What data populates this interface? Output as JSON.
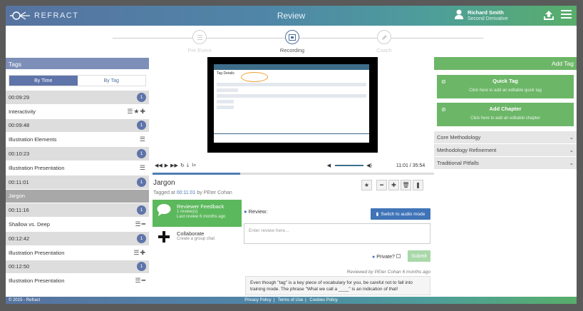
{
  "header": {
    "logo_text": "REFRACT",
    "title": "Review",
    "user_name": "Richard Smith",
    "user_role": "Second Derivative"
  },
  "steps": [
    {
      "label": "Pre Event",
      "active": false
    },
    {
      "label": "Recording",
      "active": true
    },
    {
      "label": "Coach",
      "active": false
    }
  ],
  "tags_panel": {
    "title": "Tags",
    "toggle": [
      "By Time",
      "By Tag"
    ],
    "rows": [
      {
        "label": "00:09:29",
        "kind": "time",
        "badge": "1"
      },
      {
        "label": "Interactivity",
        "kind": "tag",
        "icons": "☰★✚"
      },
      {
        "label": "00:09:48",
        "kind": "time",
        "badge": "1"
      },
      {
        "label": "Illustration Elements",
        "kind": "tag",
        "icons": "☰"
      },
      {
        "label": "00:10:23",
        "kind": "time",
        "badge": "1"
      },
      {
        "label": "Illustration Presentation",
        "kind": "tag",
        "icons": "☰"
      },
      {
        "label": "00:11:01",
        "kind": "time",
        "badge": "1"
      },
      {
        "label": "Jargon",
        "kind": "sel",
        "icons": ""
      },
      {
        "label": "00:11:16",
        "kind": "time",
        "badge": "1"
      },
      {
        "label": "Shallow vs. Deep",
        "kind": "tag",
        "icons": "☰━"
      },
      {
        "label": "00:12:42",
        "kind": "time",
        "badge": "1"
      },
      {
        "label": "Illustration Presentation",
        "kind": "tag",
        "icons": "☰✚"
      },
      {
        "label": "00:12:50",
        "kind": "time",
        "badge": "1"
      },
      {
        "label": "Illustration Presentation",
        "kind": "tag",
        "icons": "☰━"
      }
    ]
  },
  "player": {
    "time": "11:01 / 35:54",
    "progress": 0.31,
    "speed": "1x",
    "screen_heading": "Tag Details"
  },
  "tag_detail": {
    "title": "Jargon",
    "tagged_prefix": "Tagged at",
    "tagged_time": "00:11:01",
    "tagged_suffix": "by PEter Cohan"
  },
  "feedback": [
    {
      "title": "Reviewer Feedback",
      "sub1": "1 review(s)",
      "sub2": "Last review 6 months ago",
      "active": true
    },
    {
      "title": "Collaborate",
      "sub1": "Create a group chat",
      "sub2": "",
      "active": false
    }
  ],
  "review": {
    "label": "Review:",
    "switch_label": "Switch to audio mode",
    "placeholder": "Enter review here...",
    "private_label": "Private?",
    "submit_label": "Submit",
    "meta": "Reviewed by PEter Cohan 6 months ago",
    "text": "Even though \"tag\" is a key piece of vocabulary for you, be careful not to fall into training mode. The phrase \"What we call a ____\" is an indication of that!"
  },
  "right_panel": {
    "title": "Add Tag",
    "cards": [
      {
        "title": "Quick Tag",
        "sub": "Click here to add an editable quick tag"
      },
      {
        "title": "Add Chapter",
        "sub": "Click here to add an editable chapter"
      }
    ],
    "accordion": [
      "Core Methodology",
      "Methodology Refinement",
      "Traditional Pitfalls"
    ]
  },
  "footer": {
    "copyright": "© 2015 - Refract",
    "links": [
      "Privacy Policy",
      "Terms of Use",
      "Cookies Policy"
    ]
  }
}
